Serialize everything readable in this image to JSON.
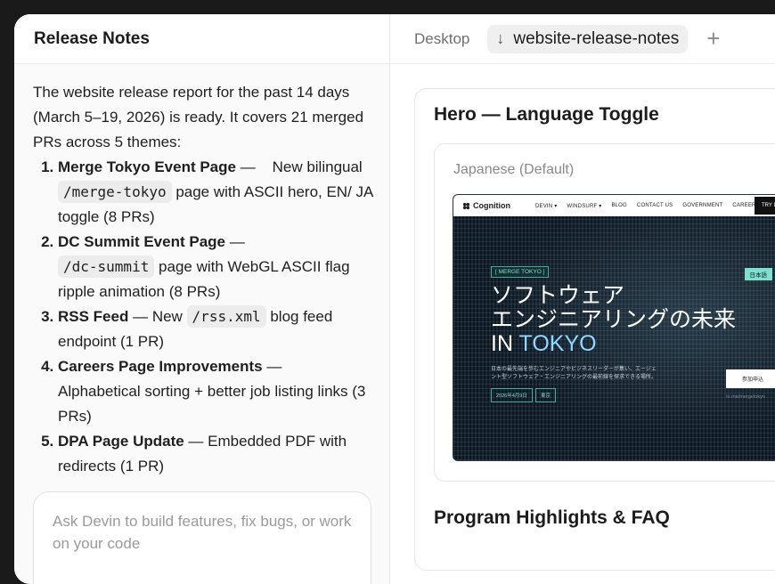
{
  "left_panel": {
    "title": "Release Notes",
    "intro": "The website release report for the past 14 days (March 5–19, 2026) is ready. It covers 21 merged PRs across 5 themes:",
    "items": [
      {
        "title": "Merge Tokyo Event Page",
        "sep": " — ",
        "pre": "New bilingual ",
        "code": "/merge-tokyo",
        "post": " page with ASCII hero, EN/ JA toggle (8 PRs)"
      },
      {
        "title": "DC Summit Event Page",
        "sep": " — ",
        "pre": "",
        "code": "/dc-summit",
        "post": " page with WebGL ASCII flag ripple animation (8 PRs)"
      },
      {
        "title": "RSS Feed",
        "sep": " — ",
        "pre": "New ",
        "code": "/rss.xml",
        "post": " blog feed endpoint (1 PR)"
      },
      {
        "title": "Careers Page Improvements",
        "sep": " — ",
        "pre": "Alphabetical sorting + better job listing links (3 PRs)",
        "code": "",
        "post": ""
      },
      {
        "title": "DPA Page Update",
        "sep": " — ",
        "pre": "Embedded PDF with redirects (1 PR)",
        "code": "",
        "post": ""
      }
    ],
    "chat_placeholder": "Ask Devin to build features, fix bugs, or work on your code"
  },
  "right_panel": {
    "tabs": {
      "desktop": "Desktop",
      "active_icon": "↓",
      "active": "website-release-notes",
      "add_icon": "+"
    },
    "section1_title": "Hero — Language Toggle",
    "card_label": "Japanese (Default)",
    "section2_title": "Program Highlights & FAQ",
    "preview": {
      "logo": "Cognition",
      "nav": [
        "DEVIN ▾",
        "WINDSURF ▾",
        "BLOG",
        "CONTACT US",
        "GOVERNMENT",
        "CAREERS"
      ],
      "try": "TRY DEVIN",
      "tag": "[ MERGE TOKYO ]",
      "tag_right": "日本語",
      "heading_line1": "ソフトウェア",
      "heading_line2": "エンジニアリングの未来",
      "heading_in": "IN ",
      "heading_tokyo": "TOKYO",
      "subtext": "日本の最先端を歩むエンジニアやビジネスリーダーが集い、エージェント型ソフトウェア・エンジニアリングの最前線を探求できる場所。",
      "date_pill": "2026年4月9日",
      "loc_pill": "東京",
      "cta": "参加申込",
      "url": "lu.ma/mergetokyo"
    }
  }
}
